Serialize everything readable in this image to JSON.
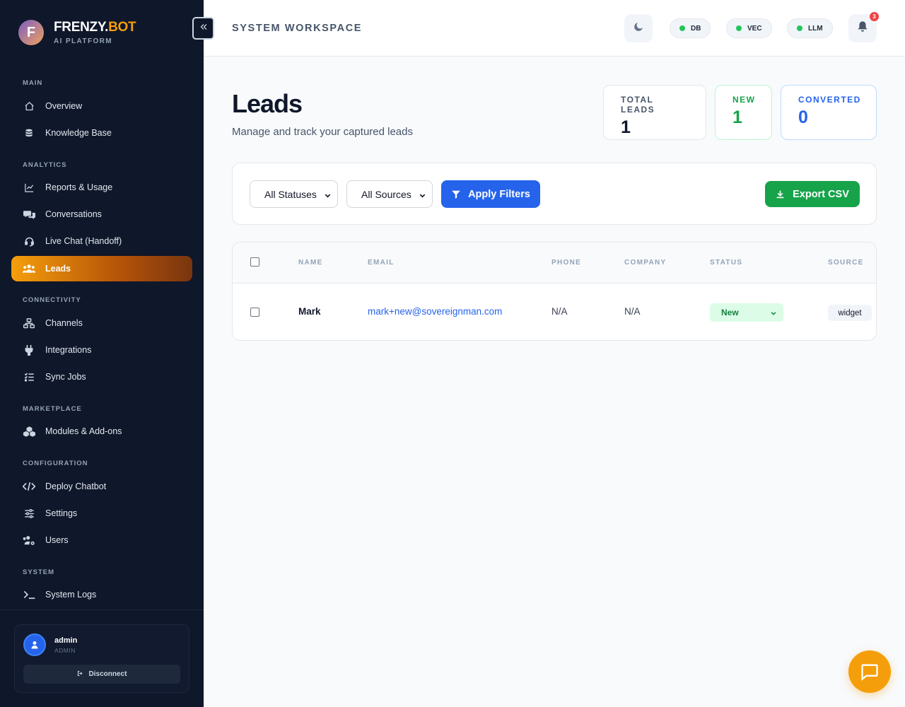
{
  "brand": {
    "logo_letter": "F",
    "name_main": "FRENZY.",
    "name_accent": "BOT",
    "subtitle": "AI PLATFORM"
  },
  "sidebar": {
    "collapse_icon": "chevrons-left-icon",
    "sections": {
      "main": "MAIN",
      "analytics": "ANALYTICS",
      "connectivity": "CONNECTIVITY",
      "marketplace": "MARKETPLACE",
      "configuration": "CONFIGURATION",
      "system": "SYSTEM"
    },
    "items": [
      {
        "label": "Overview",
        "icon": "home-icon"
      },
      {
        "label": "Knowledge Base",
        "icon": "database-icon"
      },
      {
        "label": "Reports & Usage",
        "icon": "line-chart-icon"
      },
      {
        "label": "Conversations",
        "icon": "chat-bubbles-icon"
      },
      {
        "label": "Live Chat (Handoff)",
        "icon": "headset-icon"
      },
      {
        "label": "Leads",
        "icon": "users-icon",
        "active": true
      },
      {
        "label": "Channels",
        "icon": "channels-icon"
      },
      {
        "label": "Integrations",
        "icon": "plug-icon"
      },
      {
        "label": "Sync Jobs",
        "icon": "list-check-icon"
      },
      {
        "label": "Modules & Add-ons",
        "icon": "cubes-icon"
      },
      {
        "label": "Deploy Chatbot",
        "icon": "code-icon"
      },
      {
        "label": "Settings",
        "icon": "sliders-icon"
      },
      {
        "label": "Users",
        "icon": "users-cog-icon"
      },
      {
        "label": "System Logs",
        "icon": "terminal-icon"
      }
    ],
    "user": {
      "name": "admin",
      "role": "ADMIN",
      "disconnect_label": "Disconnect"
    }
  },
  "topbar": {
    "workspace": "SYSTEM WORKSPACE",
    "status_pills": [
      "DB",
      "VEC",
      "LLM"
    ],
    "notification_count": "3"
  },
  "page": {
    "title": "Leads",
    "subtitle": "Manage and track your captured leads"
  },
  "stats": [
    {
      "label": "TOTAL LEADS",
      "value": "1"
    },
    {
      "label": "NEW",
      "value": "1"
    },
    {
      "label": "CONVERTED",
      "value": "0"
    }
  ],
  "filters": {
    "status_selected": "All Statuses",
    "source_selected": "All Sources",
    "apply_label": "Apply Filters",
    "export_label": "Export CSV"
  },
  "table": {
    "headers": [
      "NAME",
      "EMAIL",
      "PHONE",
      "COMPANY",
      "STATUS",
      "SOURCE"
    ],
    "rows": [
      {
        "name": "Mark",
        "email": "mark+new@sovereignman.com",
        "phone": "N/A",
        "company": "N/A",
        "status": "New",
        "source": "widget"
      }
    ]
  },
  "colors": {
    "sidebar_bg": "#0f172a",
    "accent_orange": "#f59e0b",
    "primary_blue": "#2563eb",
    "success_green": "#16a34a"
  }
}
